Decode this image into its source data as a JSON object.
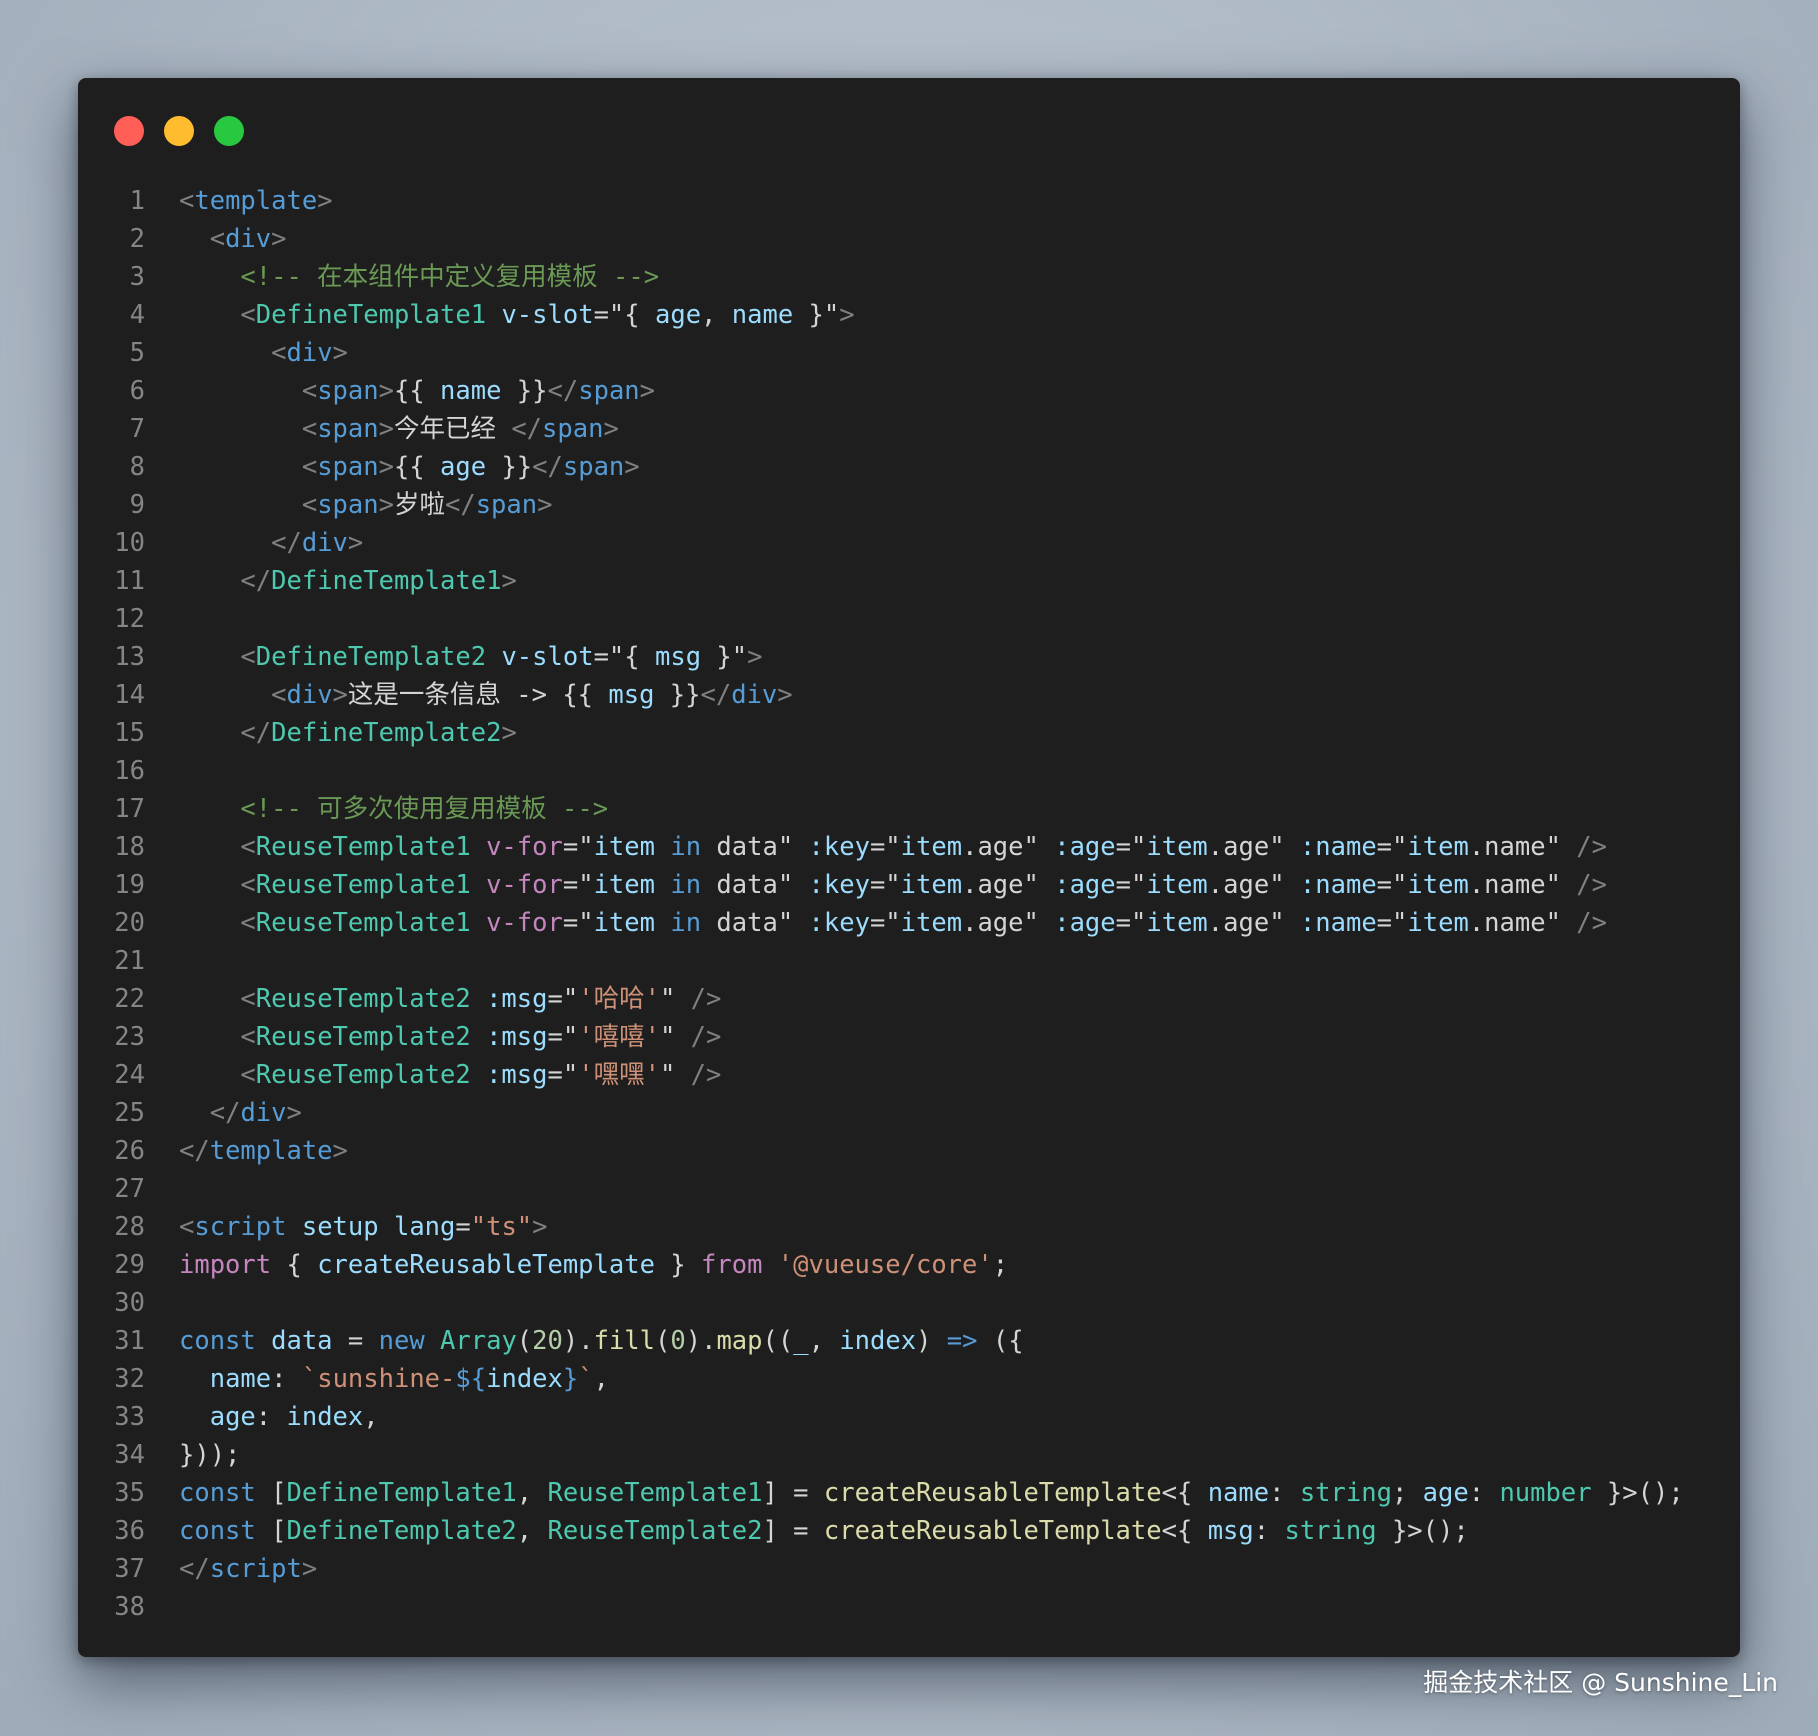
{
  "window": {
    "traffic_lights": {
      "close_color": "#ff5f57",
      "minimize_color": "#febc2e",
      "zoom_color": "#28c840"
    }
  },
  "code": {
    "lines": [
      [
        [
          "p",
          "<"
        ],
        [
          "t",
          "template"
        ],
        [
          "p",
          ">"
        ]
      ],
      [
        [
          "",
          "  "
        ],
        [
          "p",
          "<"
        ],
        [
          "t",
          "div"
        ],
        [
          "p",
          ">"
        ]
      ],
      [
        [
          "",
          "    "
        ],
        [
          "c",
          "<!-- 在本组件中定义复用模板 -->"
        ]
      ],
      [
        [
          "",
          "    "
        ],
        [
          "p",
          "<"
        ],
        [
          "g",
          "DefineTemplate1"
        ],
        [
          "",
          " "
        ],
        [
          "a",
          "v-slot"
        ],
        [
          "",
          "=\"{ "
        ],
        [
          "a",
          "age"
        ],
        [
          "",
          ", "
        ],
        [
          "a",
          "name"
        ],
        [
          "",
          " }\""
        ],
        [
          "p",
          ">"
        ]
      ],
      [
        [
          "",
          "      "
        ],
        [
          "p",
          "<"
        ],
        [
          "t",
          "div"
        ],
        [
          "p",
          ">"
        ]
      ],
      [
        [
          "",
          "        "
        ],
        [
          "p",
          "<"
        ],
        [
          "t",
          "span"
        ],
        [
          "p",
          ">"
        ],
        [
          "",
          "{{ "
        ],
        [
          "a",
          "name"
        ],
        [
          "",
          " }}"
        ],
        [
          "p",
          "</"
        ],
        [
          "t",
          "span"
        ],
        [
          "p",
          ">"
        ]
      ],
      [
        [
          "",
          "        "
        ],
        [
          "p",
          "<"
        ],
        [
          "t",
          "span"
        ],
        [
          "p",
          ">"
        ],
        [
          "",
          "今年已经 "
        ],
        [
          "p",
          "</"
        ],
        [
          "t",
          "span"
        ],
        [
          "p",
          ">"
        ]
      ],
      [
        [
          "",
          "        "
        ],
        [
          "p",
          "<"
        ],
        [
          "t",
          "span"
        ],
        [
          "p",
          ">"
        ],
        [
          "",
          "{{ "
        ],
        [
          "a",
          "age"
        ],
        [
          "",
          " }}"
        ],
        [
          "p",
          "</"
        ],
        [
          "t",
          "span"
        ],
        [
          "p",
          ">"
        ]
      ],
      [
        [
          "",
          "        "
        ],
        [
          "p",
          "<"
        ],
        [
          "t",
          "span"
        ],
        [
          "p",
          ">"
        ],
        [
          "",
          "岁啦"
        ],
        [
          "p",
          "</"
        ],
        [
          "t",
          "span"
        ],
        [
          "p",
          ">"
        ]
      ],
      [
        [
          "",
          "      "
        ],
        [
          "p",
          "</"
        ],
        [
          "t",
          "div"
        ],
        [
          "p",
          ">"
        ]
      ],
      [
        [
          "",
          "    "
        ],
        [
          "p",
          "</"
        ],
        [
          "g",
          "DefineTemplate1"
        ],
        [
          "p",
          ">"
        ]
      ],
      [],
      [
        [
          "",
          "    "
        ],
        [
          "p",
          "<"
        ],
        [
          "g",
          "DefineTemplate2"
        ],
        [
          "",
          " "
        ],
        [
          "a",
          "v-slot"
        ],
        [
          "",
          "=\"{ "
        ],
        [
          "a",
          "msg"
        ],
        [
          "",
          " }\""
        ],
        [
          "p",
          ">"
        ]
      ],
      [
        [
          "",
          "      "
        ],
        [
          "p",
          "<"
        ],
        [
          "t",
          "div"
        ],
        [
          "p",
          ">"
        ],
        [
          "",
          "这是一条信息 -> {{ "
        ],
        [
          "a",
          "msg"
        ],
        [
          "",
          " }}"
        ],
        [
          "p",
          "</"
        ],
        [
          "t",
          "div"
        ],
        [
          "p",
          ">"
        ]
      ],
      [
        [
          "",
          "    "
        ],
        [
          "p",
          "</"
        ],
        [
          "g",
          "DefineTemplate2"
        ],
        [
          "p",
          ">"
        ]
      ],
      [],
      [
        [
          "",
          "    "
        ],
        [
          "c",
          "<!-- 可多次使用复用模板 -->"
        ]
      ],
      [
        [
          "",
          "    "
        ],
        [
          "p",
          "<"
        ],
        [
          "g",
          "ReuseTemplate1"
        ],
        [
          "",
          " "
        ],
        [
          "k",
          "v-for"
        ],
        [
          "",
          "=\""
        ],
        [
          "a",
          "item"
        ],
        [
          "",
          " "
        ],
        [
          "t",
          "in"
        ],
        [
          "",
          " data\" "
        ],
        [
          "a",
          ":key"
        ],
        [
          "",
          "=\""
        ],
        [
          "a",
          "item"
        ],
        [
          "",
          ".age\" "
        ],
        [
          "a",
          ":age"
        ],
        [
          "",
          "=\""
        ],
        [
          "a",
          "item"
        ],
        [
          "",
          ".age\" "
        ],
        [
          "a",
          ":name"
        ],
        [
          "",
          "=\""
        ],
        [
          "a",
          "item"
        ],
        [
          "",
          ".name\" "
        ],
        [
          "p",
          "/>"
        ]
      ],
      [
        [
          "",
          "    "
        ],
        [
          "p",
          "<"
        ],
        [
          "g",
          "ReuseTemplate1"
        ],
        [
          "",
          " "
        ],
        [
          "k",
          "v-for"
        ],
        [
          "",
          "=\""
        ],
        [
          "a",
          "item"
        ],
        [
          "",
          " "
        ],
        [
          "t",
          "in"
        ],
        [
          "",
          " data\" "
        ],
        [
          "a",
          ":key"
        ],
        [
          "",
          "=\""
        ],
        [
          "a",
          "item"
        ],
        [
          "",
          ".age\" "
        ],
        [
          "a",
          ":age"
        ],
        [
          "",
          "=\""
        ],
        [
          "a",
          "item"
        ],
        [
          "",
          ".age\" "
        ],
        [
          "a",
          ":name"
        ],
        [
          "",
          "=\""
        ],
        [
          "a",
          "item"
        ],
        [
          "",
          ".name\" "
        ],
        [
          "p",
          "/>"
        ]
      ],
      [
        [
          "",
          "    "
        ],
        [
          "p",
          "<"
        ],
        [
          "g",
          "ReuseTemplate1"
        ],
        [
          "",
          " "
        ],
        [
          "k",
          "v-for"
        ],
        [
          "",
          "=\""
        ],
        [
          "a",
          "item"
        ],
        [
          "",
          " "
        ],
        [
          "t",
          "in"
        ],
        [
          "",
          " data\" "
        ],
        [
          "a",
          ":key"
        ],
        [
          "",
          "=\""
        ],
        [
          "a",
          "item"
        ],
        [
          "",
          ".age\" "
        ],
        [
          "a",
          ":age"
        ],
        [
          "",
          "=\""
        ],
        [
          "a",
          "item"
        ],
        [
          "",
          ".age\" "
        ],
        [
          "a",
          ":name"
        ],
        [
          "",
          "=\""
        ],
        [
          "a",
          "item"
        ],
        [
          "",
          ".name\" "
        ],
        [
          "p",
          "/>"
        ]
      ],
      [],
      [
        [
          "",
          "    "
        ],
        [
          "p",
          "<"
        ],
        [
          "g",
          "ReuseTemplate2"
        ],
        [
          "",
          " "
        ],
        [
          "a",
          ":msg"
        ],
        [
          "",
          "=\""
        ],
        [
          "s",
          "'哈哈'"
        ],
        [
          "",
          "\" "
        ],
        [
          "p",
          "/>"
        ]
      ],
      [
        [
          "",
          "    "
        ],
        [
          "p",
          "<"
        ],
        [
          "g",
          "ReuseTemplate2"
        ],
        [
          "",
          " "
        ],
        [
          "a",
          ":msg"
        ],
        [
          "",
          "=\""
        ],
        [
          "s",
          "'嘻嘻'"
        ],
        [
          "",
          "\" "
        ],
        [
          "p",
          "/>"
        ]
      ],
      [
        [
          "",
          "    "
        ],
        [
          "p",
          "<"
        ],
        [
          "g",
          "ReuseTemplate2"
        ],
        [
          "",
          " "
        ],
        [
          "a",
          ":msg"
        ],
        [
          "",
          "=\""
        ],
        [
          "s",
          "'嘿嘿'"
        ],
        [
          "",
          "\" "
        ],
        [
          "p",
          "/>"
        ]
      ],
      [
        [
          "",
          "  "
        ],
        [
          "p",
          "</"
        ],
        [
          "t",
          "div"
        ],
        [
          "p",
          ">"
        ]
      ],
      [
        [
          "p",
          "</"
        ],
        [
          "t",
          "template"
        ],
        [
          "p",
          ">"
        ]
      ],
      [],
      [
        [
          "p",
          "<"
        ],
        [
          "t",
          "script"
        ],
        [
          "",
          " "
        ],
        [
          "a",
          "setup"
        ],
        [
          "",
          " "
        ],
        [
          "a",
          "lang"
        ],
        [
          "",
          "="
        ],
        [
          "s",
          "\"ts\""
        ],
        [
          "p",
          ">"
        ]
      ],
      [
        [
          "k",
          "import"
        ],
        [
          "",
          " { "
        ],
        [
          "a",
          "createReusableTemplate"
        ],
        [
          "",
          " } "
        ],
        [
          "k",
          "from"
        ],
        [
          "",
          " "
        ],
        [
          "s",
          "'@vueuse/core'"
        ],
        [
          "",
          ";"
        ]
      ],
      [],
      [
        [
          "t",
          "const"
        ],
        [
          "",
          " "
        ],
        [
          "a",
          "data"
        ],
        [
          "",
          " = "
        ],
        [
          "t",
          "new"
        ],
        [
          "",
          " "
        ],
        [
          "g",
          "Array"
        ],
        [
          "",
          "("
        ],
        [
          "n",
          "20"
        ],
        [
          "",
          ")."
        ],
        [
          "f",
          "fill"
        ],
        [
          "",
          "("
        ],
        [
          "n",
          "0"
        ],
        [
          "",
          ")."
        ],
        [
          "f",
          "map"
        ],
        [
          "",
          "(("
        ],
        [
          "a",
          "_"
        ],
        [
          "",
          ", "
        ],
        [
          "a",
          "index"
        ],
        [
          "",
          ") "
        ],
        [
          "t",
          "=>"
        ],
        [
          "",
          " ({"
        ]
      ],
      [
        [
          "",
          "  "
        ],
        [
          "a",
          "name"
        ],
        [
          "",
          ": "
        ],
        [
          "s",
          "`sunshine-"
        ],
        [
          "t",
          "${"
        ],
        [
          "a",
          "index"
        ],
        [
          "t",
          "}"
        ],
        [
          "s",
          "`"
        ],
        [
          "",
          ","
        ]
      ],
      [
        [
          "",
          "  "
        ],
        [
          "a",
          "age"
        ],
        [
          "",
          ": "
        ],
        [
          "a",
          "index"
        ],
        [
          "",
          ","
        ]
      ],
      [
        [
          "",
          "}));"
        ]
      ],
      [
        [
          "t",
          "const"
        ],
        [
          "",
          " ["
        ],
        [
          "g",
          "DefineTemplate1"
        ],
        [
          "",
          ", "
        ],
        [
          "g",
          "ReuseTemplate1"
        ],
        [
          "",
          "] = "
        ],
        [
          "f",
          "createReusableTemplate"
        ],
        [
          "",
          "<{ "
        ],
        [
          "a",
          "name"
        ],
        [
          "",
          ": "
        ],
        [
          "g",
          "string"
        ],
        [
          "",
          "; "
        ],
        [
          "a",
          "age"
        ],
        [
          "",
          ": "
        ],
        [
          "g",
          "number"
        ],
        [
          "",
          " }>();"
        ]
      ],
      [
        [
          "t",
          "const"
        ],
        [
          "",
          " ["
        ],
        [
          "g",
          "DefineTemplate2"
        ],
        [
          "",
          ", "
        ],
        [
          "g",
          "ReuseTemplate2"
        ],
        [
          "",
          "] = "
        ],
        [
          "f",
          "createReusableTemplate"
        ],
        [
          "",
          "<{ "
        ],
        [
          "a",
          "msg"
        ],
        [
          "",
          ": "
        ],
        [
          "g",
          "string"
        ],
        [
          "",
          " }>();"
        ]
      ],
      [
        [
          "p",
          "</"
        ],
        [
          "t",
          "script"
        ],
        [
          "p",
          ">"
        ]
      ],
      []
    ]
  },
  "watermark": "掘金技术社区 @ Sunshine_Lin"
}
